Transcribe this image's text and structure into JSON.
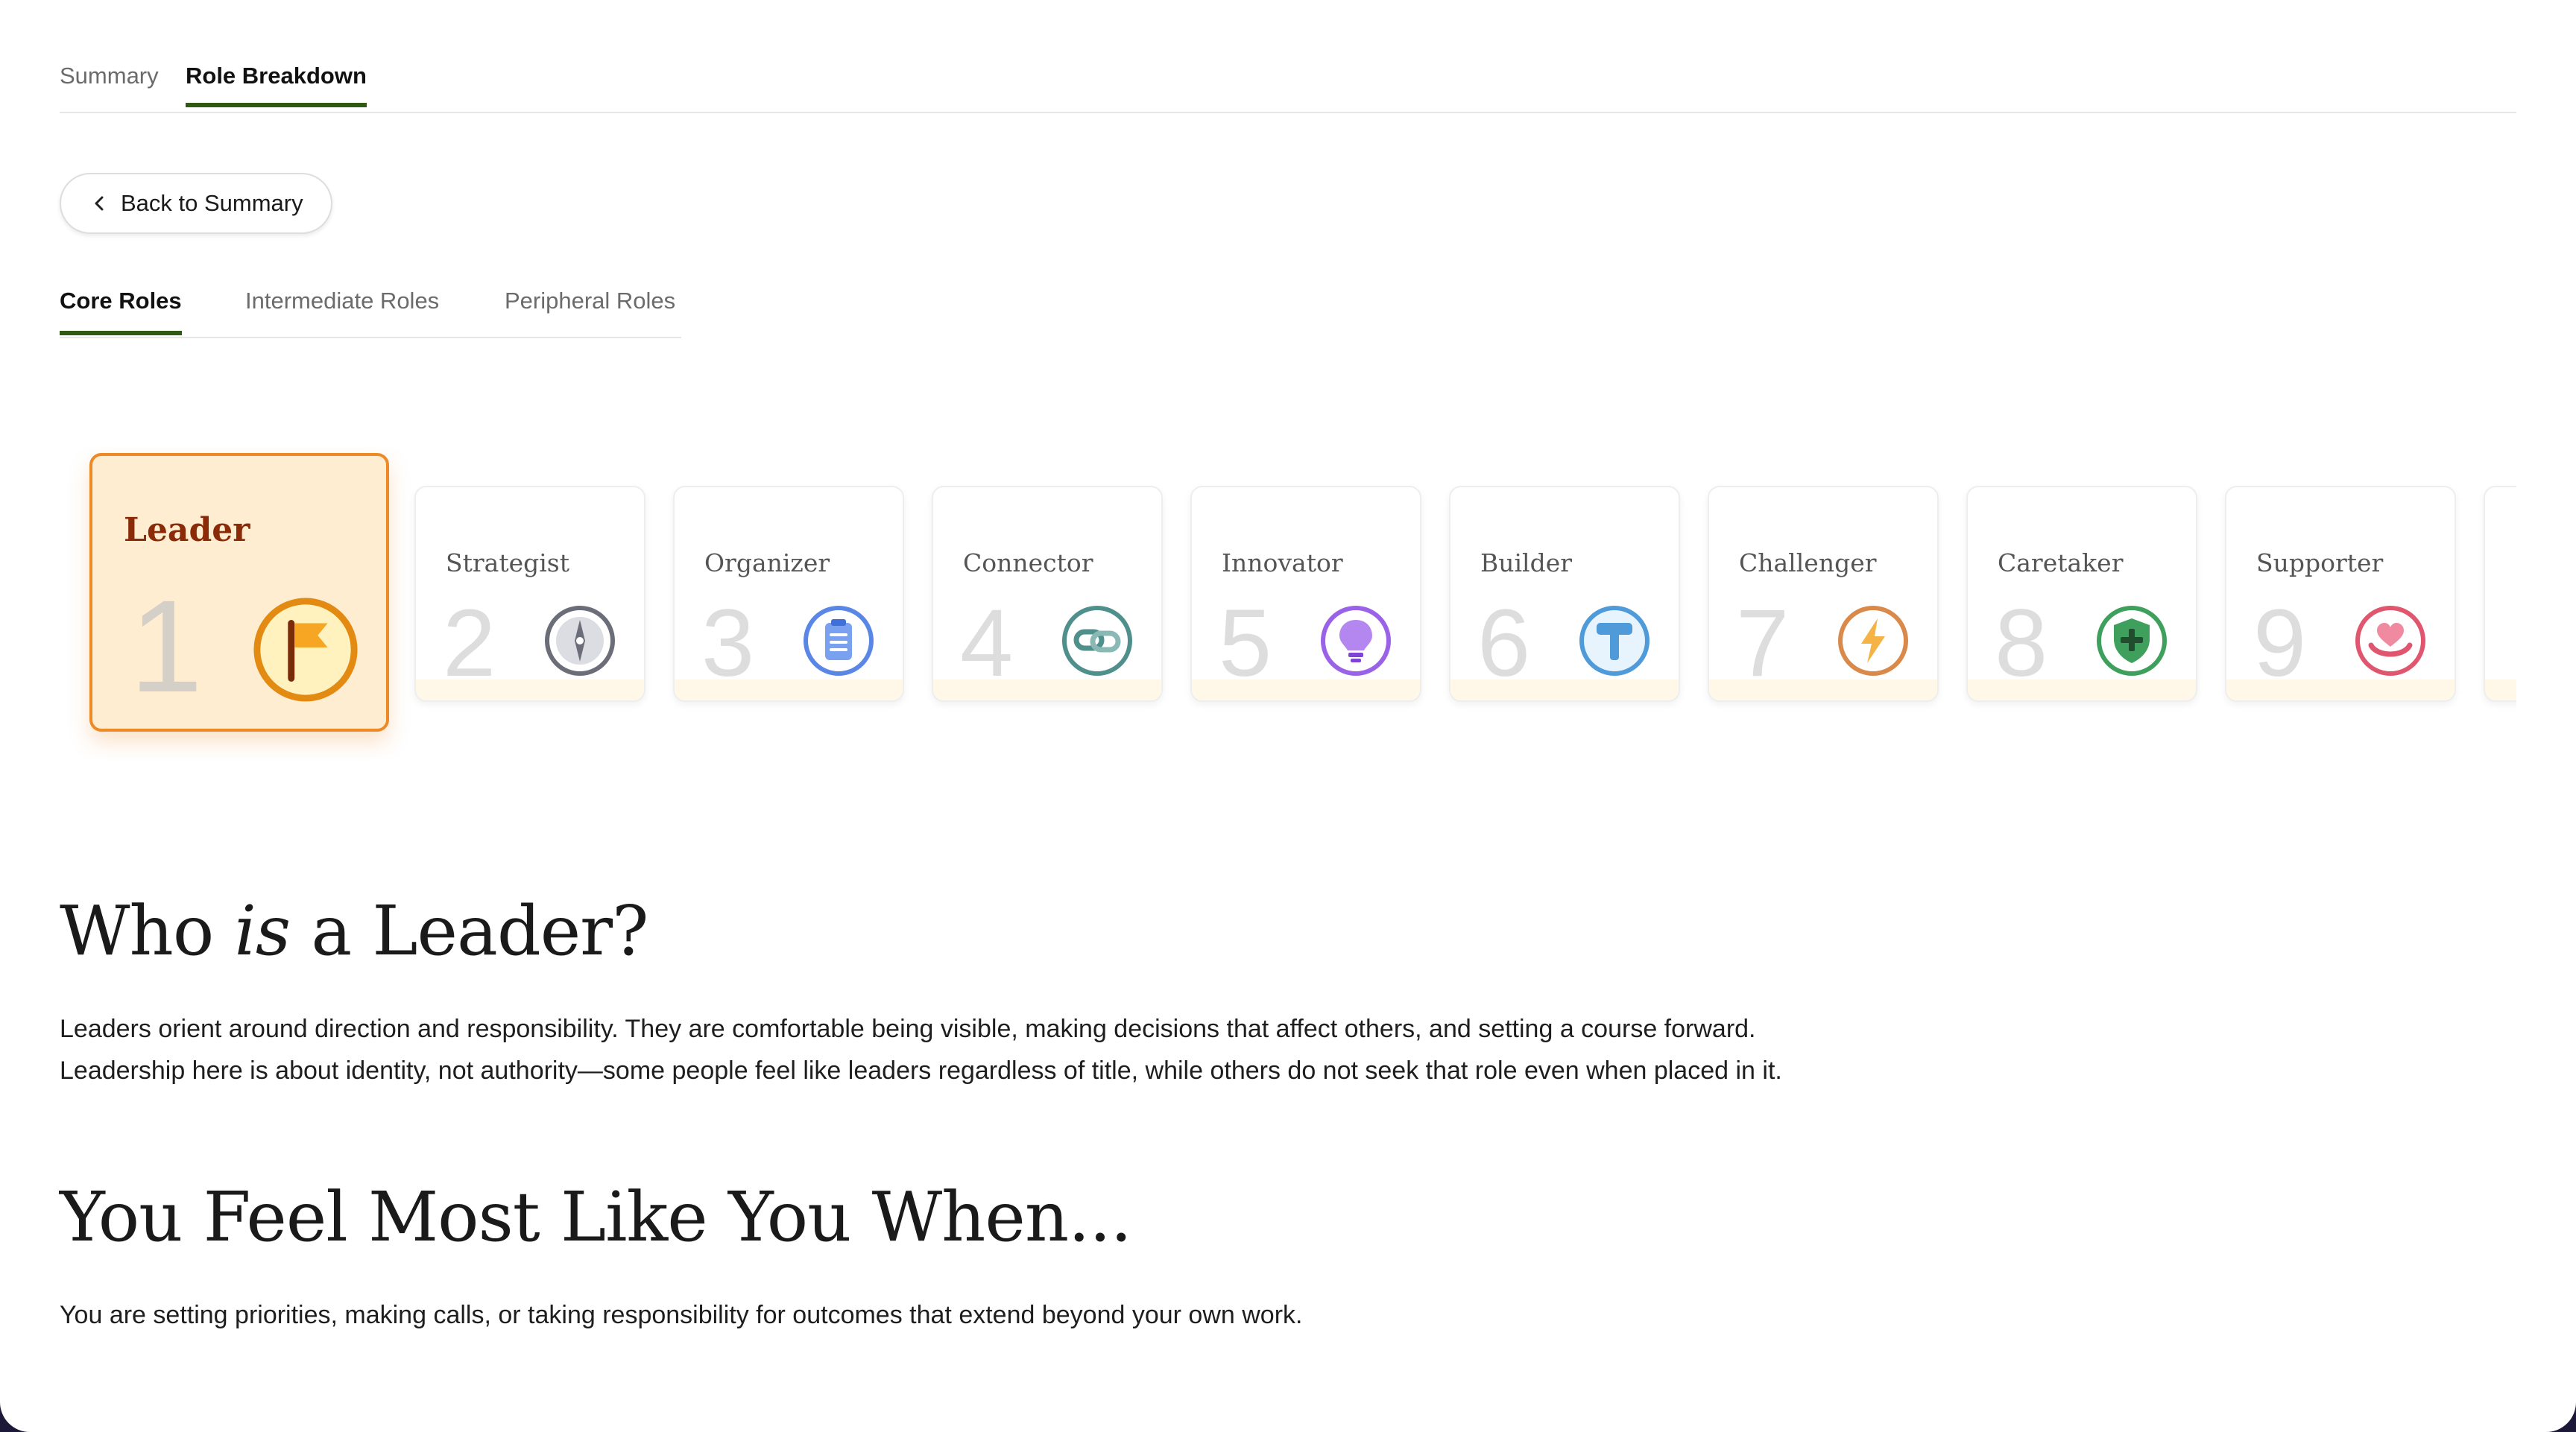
{
  "top_tabs": [
    {
      "label": "Summary",
      "active": false
    },
    {
      "label": "Role Breakdown",
      "active": true
    }
  ],
  "back_button": {
    "label": "Back to Summary"
  },
  "sub_tabs": [
    {
      "label": "Core Roles",
      "active": true
    },
    {
      "label": "Intermediate Roles",
      "active": false
    },
    {
      "label": "Peripheral Roles",
      "active": false
    }
  ],
  "roles": [
    {
      "name": "Leader",
      "rank": "1",
      "icon": "flag-icon",
      "color": "#e38a12",
      "active": true
    },
    {
      "name": "Strategist",
      "rank": "2",
      "icon": "compass-icon",
      "color": "#6b6e78"
    },
    {
      "name": "Organizer",
      "rank": "3",
      "icon": "clipboard-icon",
      "color": "#5a86e6"
    },
    {
      "name": "Connector",
      "rank": "4",
      "icon": "link-icon",
      "color": "#4f8f8c"
    },
    {
      "name": "Innovator",
      "rank": "5",
      "icon": "lightbulb-icon",
      "color": "#9a62e6"
    },
    {
      "name": "Builder",
      "rank": "6",
      "icon": "hammer-icon",
      "color": "#4f9ad8"
    },
    {
      "name": "Challenger",
      "rank": "7",
      "icon": "lightning-icon",
      "color": "#d9894a"
    },
    {
      "name": "Caretaker",
      "rank": "8",
      "icon": "shield-icon",
      "color": "#3ea05c"
    },
    {
      "name": "Supporter",
      "rank": "9",
      "icon": "heart-hands-icon",
      "color": "#e0566e"
    }
  ],
  "section1": {
    "heading_pre": "Who ",
    "heading_em": "is",
    "heading_post": " a Leader?",
    "body_line1": "Leaders orient around direction and responsibility. They are comfortable being visible, making decisions that affect others, and setting a course forward.",
    "body_line2": "Leadership here is about identity, not authority—some people feel like leaders regardless of title, while others do not seek that role even when placed in it."
  },
  "section2": {
    "heading": "You Feel Most Like You When...",
    "body": "You are setting priorities, making calls, or taking responsibility for outcomes that extend beyond your own work."
  }
}
